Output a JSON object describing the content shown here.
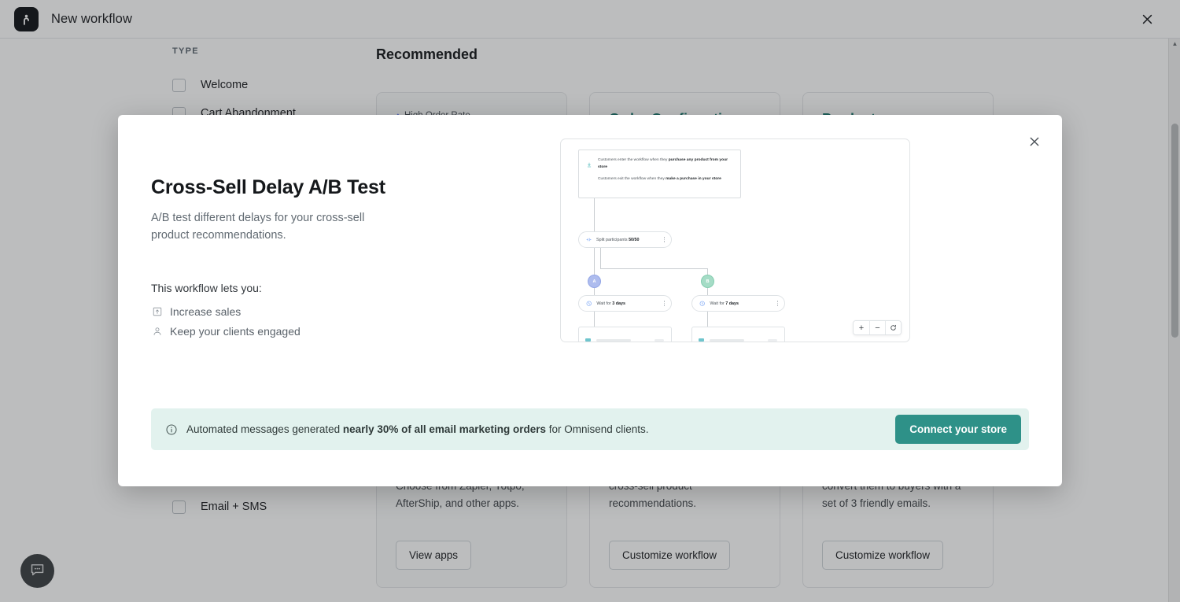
{
  "appbar": {
    "title": "New workflow",
    "logo_icon": "omnisend-logo-icon",
    "close_icon": "close-icon"
  },
  "filters": {
    "heading": "TYPE",
    "items": [
      {
        "label": "Welcome",
        "checked": false
      },
      {
        "label": "Cart Abandonment",
        "checked": false
      },
      {
        "label": "Email + SMS",
        "checked": false
      }
    ]
  },
  "recommended": {
    "section_title": "Recommended",
    "cards": [
      {
        "badge": "High Order Rate",
        "badge_icon": "arrow-up-icon",
        "title": "",
        "desc": "Choose from Zapier, Yotpo, AfterShip, and other apps.",
        "button": "View apps"
      },
      {
        "badge": "",
        "title": "Order Confirmation",
        "desc": "cross-sell product recommendations.",
        "button": "Customize workflow"
      },
      {
        "badge": "",
        "title": "Product Abandonment",
        "desc": "convert them to buyers with a set of 3 friendly emails.",
        "button": "Customize workflow"
      }
    ]
  },
  "chat_launcher": {
    "icon": "chat-bubble-icon"
  },
  "scrollbar": {
    "up_arrow_icon": "scroll-up-arrow-icon"
  },
  "modal": {
    "close_icon": "close-icon",
    "title": "Cross-Sell Delay A/B Test",
    "description": "A/B test different delays for your cross-sell product recommendations.",
    "benefits_title": "This workflow lets you:",
    "benefits": [
      {
        "icon": "chart-increase-icon",
        "label": "Increase sales"
      },
      {
        "icon": "person-icon",
        "label": "Keep your clients engaged"
      }
    ],
    "preview": {
      "trigger": {
        "icon": "trigger-bolt-icon",
        "entry_prefix": "Customers enter the workflow when they ",
        "entry_bold": "purchase any product from your store",
        "exit_prefix": "Customers exit the workflow when they ",
        "exit_bold": "make a purchase in your store"
      },
      "nodes": [
        {
          "icon": "split-icon",
          "prefix": "Split participants ",
          "bold": "50/50",
          "menu_icon": "more-options-icon"
        },
        {
          "icon": "clock-icon",
          "prefix": "Wait for ",
          "bold": "3 days",
          "menu_icon": "more-options-icon"
        },
        {
          "icon": "clock-icon",
          "prefix": "Wait for ",
          "bold": "7 days",
          "menu_icon": "more-options-icon"
        }
      ],
      "branches": [
        {
          "label": "A",
          "color": "#aebcee"
        },
        {
          "label": "B",
          "color": "#a5dcc6"
        }
      ],
      "zoom_controls": [
        {
          "icon": "zoom-in-icon",
          "label": "+"
        },
        {
          "icon": "zoom-out-icon",
          "label": "−"
        },
        {
          "icon": "reset-view-icon",
          "label": ""
        }
      ]
    },
    "banner": {
      "icon": "info-icon",
      "prefix": "Automated messages generated ",
      "bold": "nearly 30% of all email marketing orders",
      "suffix": " for Omnisend clients.",
      "button": "Connect your store"
    }
  },
  "colors": {
    "accent_teal": "#2e9188",
    "banner_bg": "#e2f2ee",
    "card_title": "#1e7a70",
    "branch_a": "#aebcee",
    "branch_b": "#a5dcc6"
  }
}
